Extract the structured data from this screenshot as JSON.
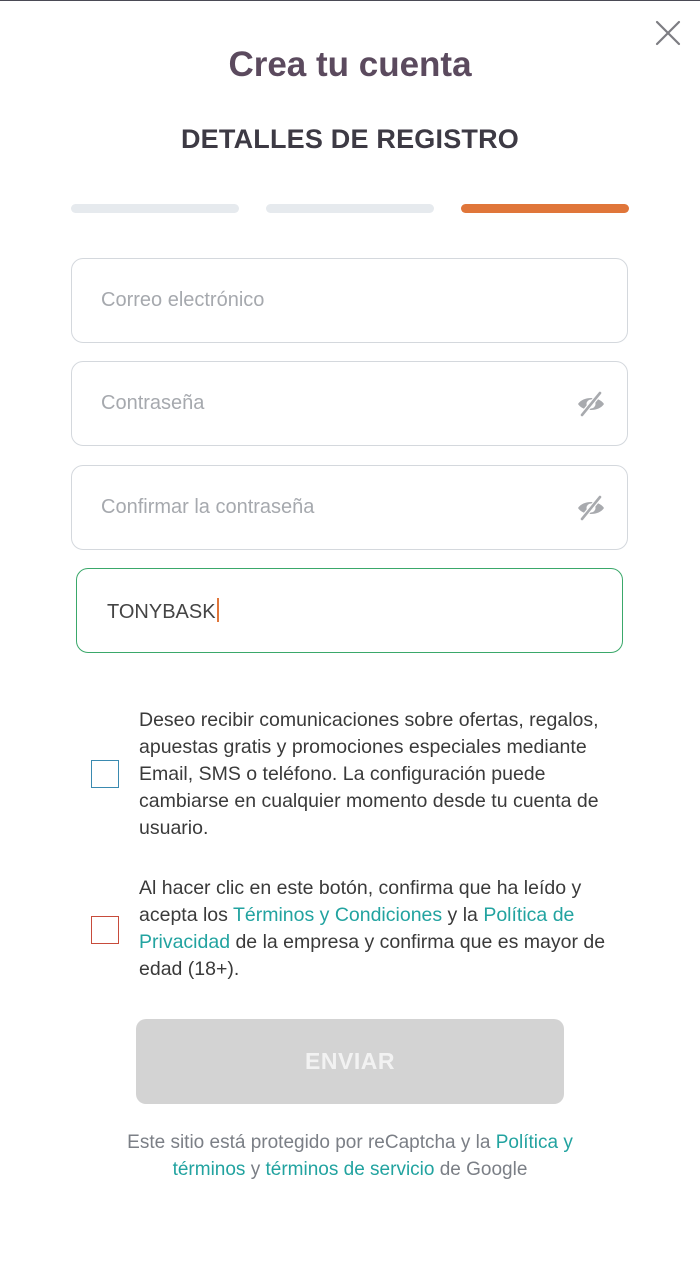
{
  "header": {
    "title": "Crea tu cuenta",
    "subtitle": "DETALLES DE REGISTRO"
  },
  "progress": {
    "total_steps": 3,
    "current_step": 3,
    "active_color": "#e0763a",
    "inactive_color": "#e6eaee"
  },
  "form": {
    "email": {
      "placeholder": "Correo electrónico",
      "value": ""
    },
    "password": {
      "placeholder": "Contraseña",
      "value": "",
      "toggle_icon": "eye-slash-icon"
    },
    "confirm_password": {
      "placeholder": "Confirmar la contraseña",
      "value": "",
      "toggle_icon": "eye-slash-icon"
    },
    "promo_code": {
      "value": "TONYBASK",
      "focus_color": "#3aa86a"
    }
  },
  "consents": {
    "marketing": {
      "text": "Deseo recibir comunicaciones sobre ofertas, regalos, apuestas gratis y promociones especiales mediante Email, SMS o teléfono. La configuración puede cambiarse en cualquier momento desde tu cuenta de usuario.",
      "checked": false,
      "border_color": "#3a8ab0"
    },
    "terms": {
      "text_1": "Al hacer clic en este botón, confirma que ha leído y acepta los ",
      "link_terms": "Términos y Condiciones",
      "text_2": " y la ",
      "link_privacy": "Política de Privacidad",
      "text_3": " de la empresa y confirma que es mayor de edad (18+).",
      "checked": false,
      "border_color": "#c74b3b"
    }
  },
  "submit": {
    "label": "ENVIAR",
    "disabled": true
  },
  "footer": {
    "text_1": "Este sitio está protegido por reCaptcha y la ",
    "link_policy": "Política y términos",
    "text_2": " y ",
    "link_service": "términos de servicio",
    "text_3": " de Google"
  },
  "colors": {
    "title": "#5b4a5e",
    "link": "#22a3a0",
    "button_disabled_bg": "#d3d3d3"
  }
}
